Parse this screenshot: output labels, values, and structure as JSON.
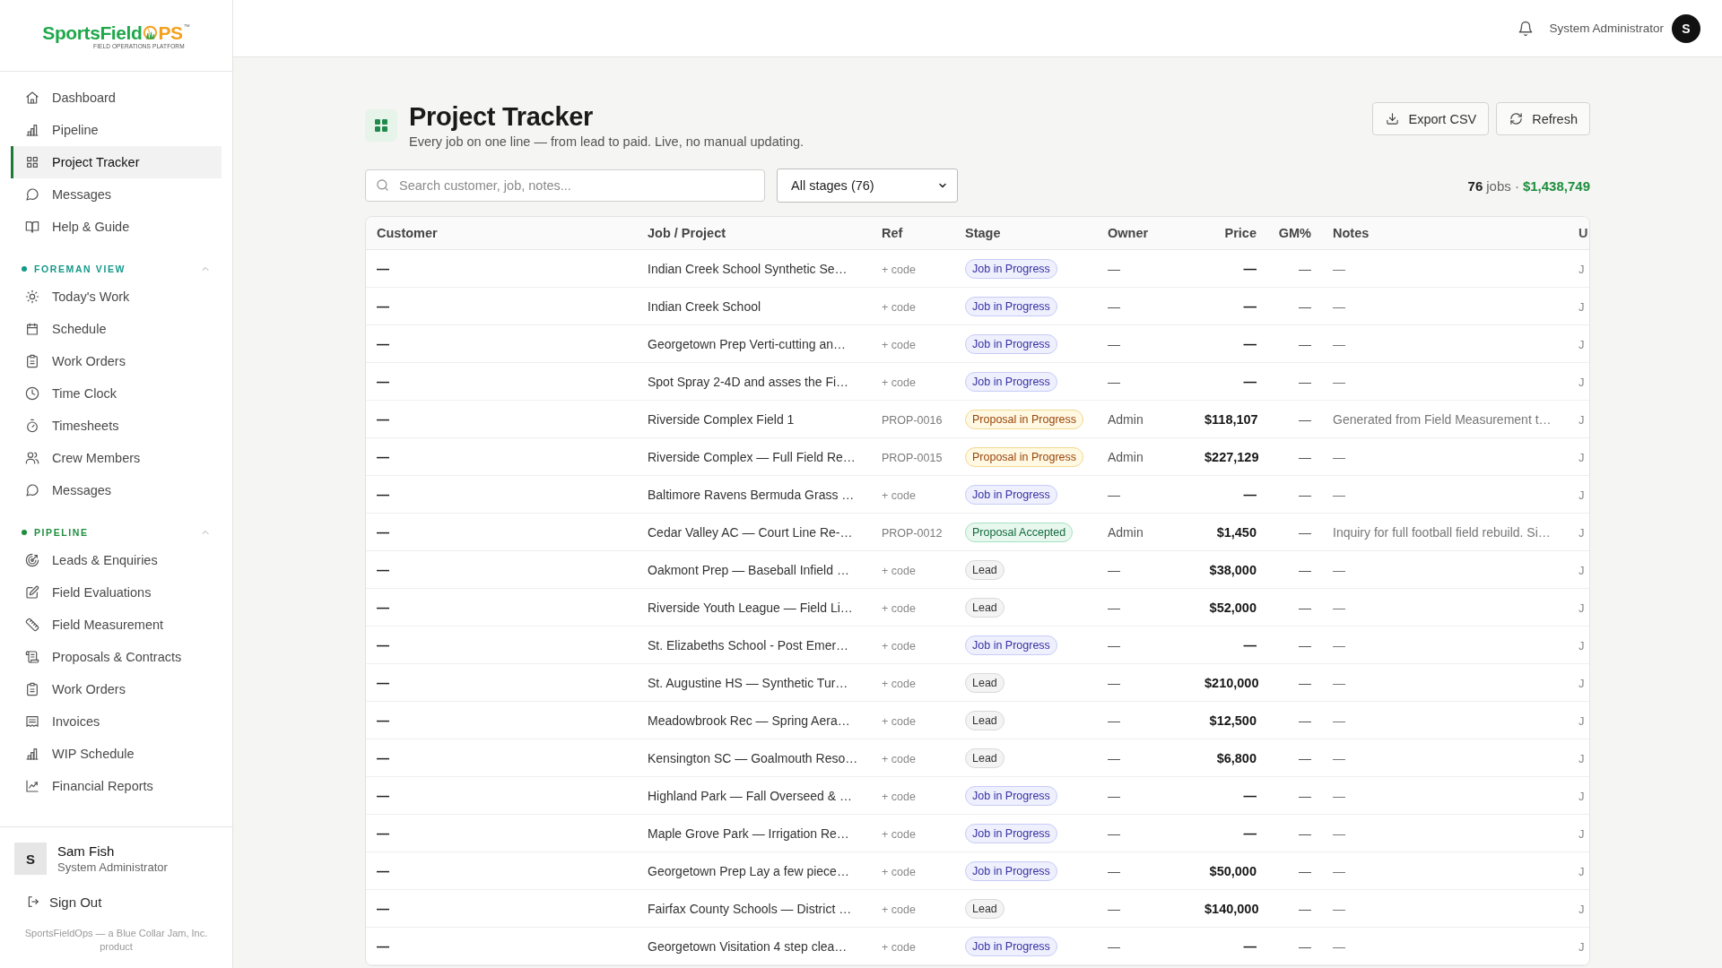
{
  "sidebar": {
    "logo": {
      "wordmark": "SportsField",
      "accent": "PS",
      "trademark": "™",
      "tagline": "FIELD OPERATIONS PLATFORM"
    },
    "nav": [
      {
        "label": "Dashboard",
        "selected": false
      },
      {
        "label": "Pipeline",
        "selected": false
      },
      {
        "label": "Project Tracker",
        "selected": true
      },
      {
        "label": "Messages",
        "selected": false
      },
      {
        "label": "Help & Guide",
        "selected": false
      }
    ],
    "sections": [
      {
        "title": "FOREMAN VIEW",
        "color": "#15998a",
        "expanded": true,
        "items": [
          {
            "label": "Today's Work",
            "selected": false
          },
          {
            "label": "Schedule",
            "selected": false
          },
          {
            "label": "Work Orders",
            "selected": false
          },
          {
            "label": "Time Clock",
            "selected": false
          },
          {
            "label": "Timesheets",
            "selected": false
          },
          {
            "label": "Crew Members",
            "selected": false
          },
          {
            "label": "Messages",
            "selected": false
          }
        ]
      },
      {
        "title": "PIPELINE",
        "color": "#1e8e3e",
        "expanded": true,
        "items": [
          {
            "label": "Leads & Enquiries",
            "selected": false
          },
          {
            "label": "Field Evaluations",
            "selected": false
          },
          {
            "label": "Field Measurement",
            "selected": false
          },
          {
            "label": "Proposals & Contracts",
            "selected": false
          },
          {
            "label": "Work Orders",
            "selected": false
          },
          {
            "label": "Invoices",
            "selected": false
          },
          {
            "label": "WIP Schedule",
            "selected": false
          },
          {
            "label": "Financial Reports",
            "selected": false
          }
        ]
      }
    ],
    "user": {
      "initial": "S",
      "name": "Sam Fish",
      "role": "System Administrator"
    },
    "sign_out": "Sign Out",
    "footer": "SportsFieldOps — a Blue Collar Jam, Inc. product"
  },
  "top_bar": {
    "user_role": "System Administrator",
    "avatar_initial": "S"
  },
  "page": {
    "title": "Project Tracker",
    "subtitle": "Every job on one line — from lead to paid. Live, no manual updating.",
    "buttons": [
      "Export CSV",
      "Refresh"
    ]
  },
  "filters": {
    "search": {
      "placeholder": "Search customer, job, notes..."
    },
    "stage_filter": "All stages (76)"
  },
  "summary": {
    "count": "76",
    "label": "jobs ·",
    "total": "$1,438,749"
  },
  "table": {
    "columns": [
      {
        "label": "Customer",
        "kind": "text"
      },
      {
        "label": "Job / Project",
        "kind": "text"
      },
      {
        "label": "Ref",
        "kind": "text"
      },
      {
        "label": "Stage",
        "kind": "text"
      },
      {
        "label": "Owner",
        "kind": "text"
      },
      {
        "label": "Price",
        "kind": "number"
      },
      {
        "label": "GM%",
        "kind": "number"
      },
      {
        "label": "Notes",
        "kind": "text"
      },
      {
        "label": "U",
        "kind": "text"
      }
    ],
    "rows": [
      {
        "customer": "—",
        "job": "Indian Creek School Synthetic Se…",
        "ref": {
          "text": "+ code",
          "kind": "add"
        },
        "stage": {
          "label": "Job in Progress",
          "kind": "job_in_progress"
        },
        "owner": "—",
        "price": "—",
        "gm": "—",
        "notes": "—",
        "column_9": "J"
      },
      {
        "customer": "—",
        "job": "Indian Creek School",
        "ref": {
          "text": "+ code",
          "kind": "add"
        },
        "stage": {
          "label": "Job in Progress",
          "kind": "job_in_progress"
        },
        "owner": "—",
        "price": "—",
        "gm": "—",
        "notes": "—",
        "column_9": "J"
      },
      {
        "customer": "—",
        "job": "Georgetown Prep Verti-cutting an…",
        "ref": {
          "text": "+ code",
          "kind": "add"
        },
        "stage": {
          "label": "Job in Progress",
          "kind": "job_in_progress"
        },
        "owner": "—",
        "price": "—",
        "gm": "—",
        "notes": "—",
        "column_9": "J"
      },
      {
        "customer": "—",
        "job": "Spot Spray 2-4D and asses the Fi…",
        "ref": {
          "text": "+ code",
          "kind": "add"
        },
        "stage": {
          "label": "Job in Progress",
          "kind": "job_in_progress"
        },
        "owner": "—",
        "price": "—",
        "gm": "—",
        "notes": "—",
        "column_9": "J"
      },
      {
        "customer": "—",
        "job": "Riverside Complex Field 1",
        "ref": {
          "text": "PROP-0016",
          "kind": "code"
        },
        "stage": {
          "label": "Proposal in Progress",
          "kind": "proposal_in_progress"
        },
        "owner": "Admin",
        "price": "$118,107",
        "gm": "—",
        "notes": "Generated from Field Measurement t…",
        "column_9": "J"
      },
      {
        "customer": "—",
        "job": "Riverside Complex — Full Field Re…",
        "ref": {
          "text": "PROP-0015",
          "kind": "code"
        },
        "stage": {
          "label": "Proposal in Progress",
          "kind": "proposal_in_progress"
        },
        "owner": "Admin",
        "price": "$227,129",
        "gm": "—",
        "notes": "—",
        "column_9": "J"
      },
      {
        "customer": "—",
        "job": "Baltimore Ravens Bermuda Grass …",
        "ref": {
          "text": "+ code",
          "kind": "add"
        },
        "stage": {
          "label": "Job in Progress",
          "kind": "job_in_progress"
        },
        "owner": "—",
        "price": "—",
        "gm": "—",
        "notes": "—",
        "column_9": "J"
      },
      {
        "customer": "—",
        "job": "Cedar Valley AC — Court Line Re-…",
        "ref": {
          "text": "PROP-0012",
          "kind": "code"
        },
        "stage": {
          "label": "Proposal Accepted",
          "kind": "proposal_accepted"
        },
        "owner": "Admin",
        "price": "$1,450",
        "gm": "—",
        "notes": "Inquiry for full football field rebuild. Si…",
        "column_9": "J"
      },
      {
        "customer": "—",
        "job": "Oakmont Prep — Baseball Infield …",
        "ref": {
          "text": "+ code",
          "kind": "add"
        },
        "stage": {
          "label": "Lead",
          "kind": "lead"
        },
        "owner": "—",
        "price": "$38,000",
        "gm": "—",
        "notes": "—",
        "column_9": "J"
      },
      {
        "customer": "—",
        "job": "Riverside Youth League — Field Li…",
        "ref": {
          "text": "+ code",
          "kind": "add"
        },
        "stage": {
          "label": "Lead",
          "kind": "lead"
        },
        "owner": "—",
        "price": "$52,000",
        "gm": "—",
        "notes": "—",
        "column_9": "J"
      },
      {
        "customer": "—",
        "job": "St. Elizabeths School - Post Emer…",
        "ref": {
          "text": "+ code",
          "kind": "add"
        },
        "stage": {
          "label": "Job in Progress",
          "kind": "job_in_progress"
        },
        "owner": "—",
        "price": "—",
        "gm": "—",
        "notes": "—",
        "column_9": "J"
      },
      {
        "customer": "—",
        "job": "St. Augustine HS — Synthetic Tur…",
        "ref": {
          "text": "+ code",
          "kind": "add"
        },
        "stage": {
          "label": "Lead",
          "kind": "lead"
        },
        "owner": "—",
        "price": "$210,000",
        "gm": "—",
        "notes": "—",
        "column_9": "J"
      },
      {
        "customer": "—",
        "job": "Meadowbrook Rec — Spring Aera…",
        "ref": {
          "text": "+ code",
          "kind": "add"
        },
        "stage": {
          "label": "Lead",
          "kind": "lead"
        },
        "owner": "—",
        "price": "$12,500",
        "gm": "—",
        "notes": "—",
        "column_9": "J"
      },
      {
        "customer": "—",
        "job": "Kensington SC — Goalmouth Reso…",
        "ref": {
          "text": "+ code",
          "kind": "add"
        },
        "stage": {
          "label": "Lead",
          "kind": "lead"
        },
        "owner": "—",
        "price": "$6,800",
        "gm": "—",
        "notes": "—",
        "column_9": "J"
      },
      {
        "customer": "—",
        "job": "Highland Park — Fall Overseed & …",
        "ref": {
          "text": "+ code",
          "kind": "add"
        },
        "stage": {
          "label": "Job in Progress",
          "kind": "job_in_progress"
        },
        "owner": "—",
        "price": "—",
        "gm": "—",
        "notes": "—",
        "column_9": "J"
      },
      {
        "customer": "—",
        "job": "Maple Grove Park — Irrigation Re…",
        "ref": {
          "text": "+ code",
          "kind": "add"
        },
        "stage": {
          "label": "Job in Progress",
          "kind": "job_in_progress"
        },
        "owner": "—",
        "price": "—",
        "gm": "—",
        "notes": "—",
        "column_9": "J"
      },
      {
        "customer": "—",
        "job": "Georgetown Prep Lay a few piece…",
        "ref": {
          "text": "+ code",
          "kind": "add"
        },
        "stage": {
          "label": "Job in Progress",
          "kind": "job_in_progress"
        },
        "owner": "—",
        "price": "$50,000",
        "gm": "—",
        "notes": "—",
        "column_9": "J"
      },
      {
        "customer": "—",
        "job": "Fairfax County Schools — District …",
        "ref": {
          "text": "+ code",
          "kind": "add"
        },
        "stage": {
          "label": "Lead",
          "kind": "lead"
        },
        "owner": "—",
        "price": "$140,000",
        "gm": "—",
        "notes": "—",
        "column_9": "J"
      },
      {
        "customer": "—",
        "job": "Georgetown Visitation 4 step clea…",
        "ref": {
          "text": "+ code",
          "kind": "add"
        },
        "stage": {
          "label": "Job in Progress",
          "kind": "job_in_progress"
        },
        "owner": "—",
        "price": "—",
        "gm": "—",
        "notes": "—",
        "column_9": "J"
      }
    ]
  }
}
